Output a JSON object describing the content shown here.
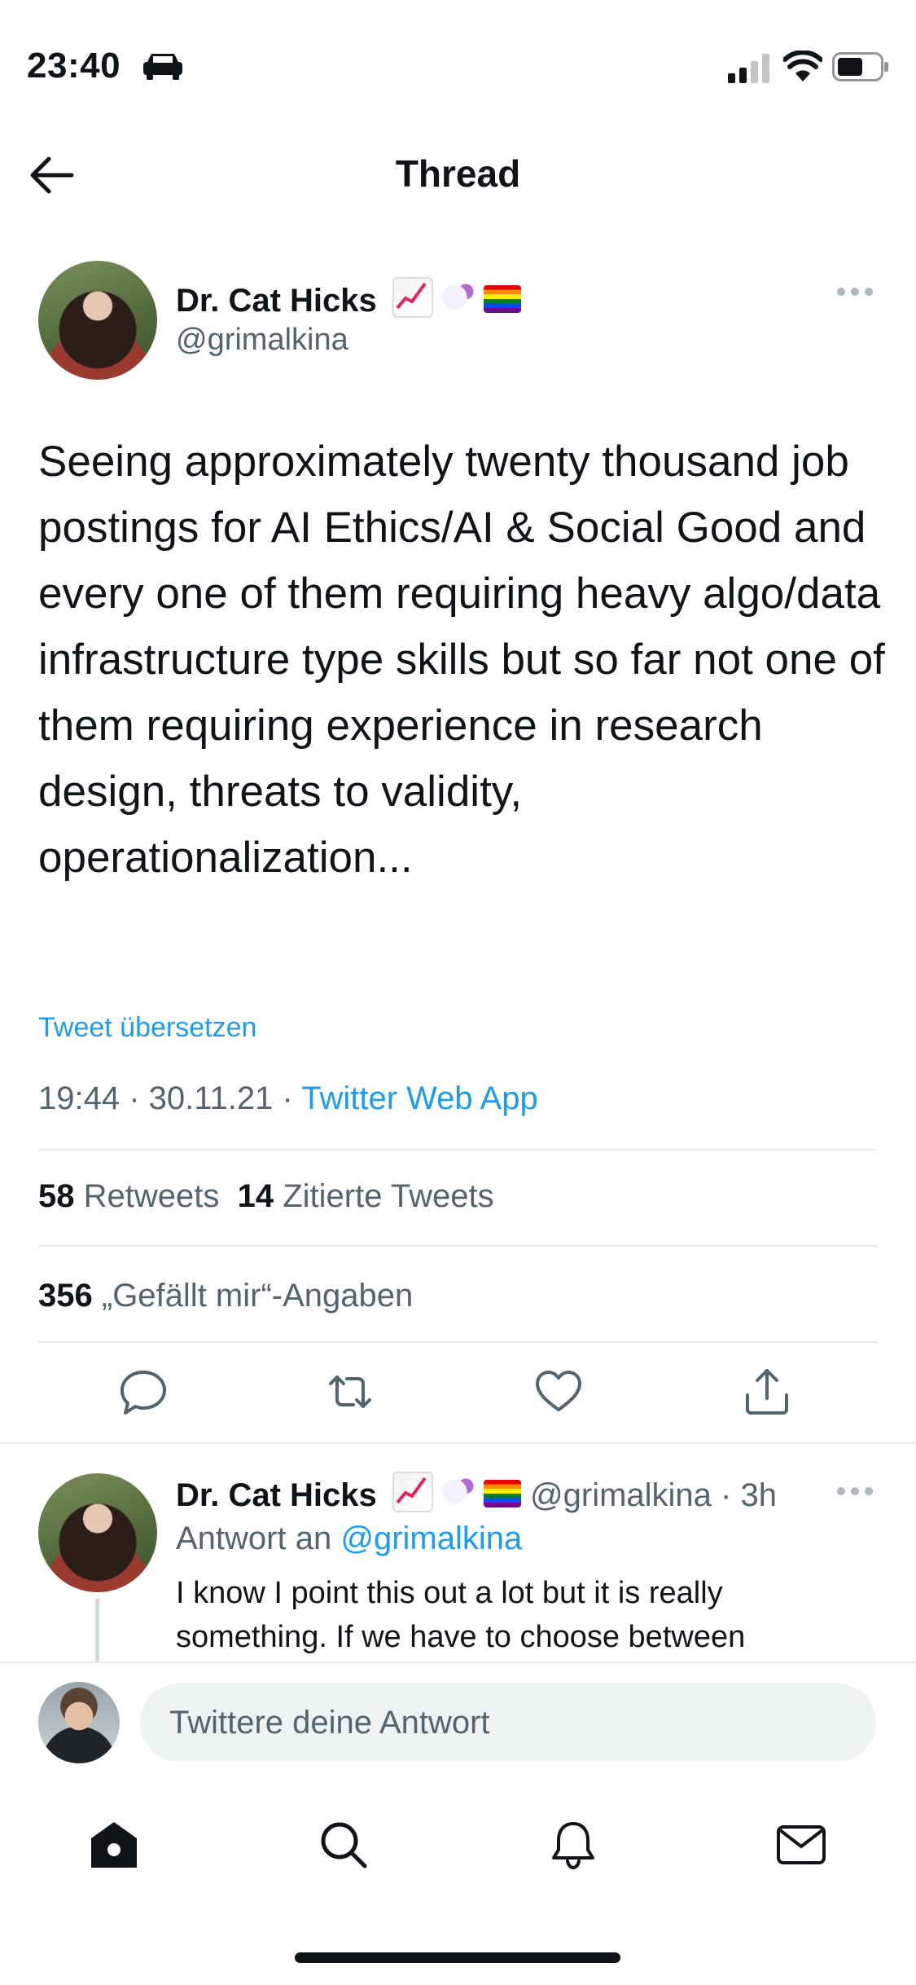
{
  "status_bar": {
    "time": "23:40"
  },
  "header": {
    "title": "Thread"
  },
  "tweet": {
    "display_name": "Dr. Cat Hicks",
    "handle": "@grimalkina",
    "text": "Seeing approximately twenty thousand job postings for AI Ethics/AI & Social Good and every one of them requiring heavy algo/data infrastructure type skills but so far not one of them requiring experience in research design, threats to validity, operationalization...",
    "translate_label": "Tweet übersetzen",
    "time": "19:44",
    "date": "30.11.21",
    "source": "Twitter Web App",
    "retweets_count": "58",
    "retweets_label": "Retweets",
    "quotes_count": "14",
    "quotes_label": "Zitierte Tweets",
    "likes_count": "356",
    "likes_label": "„Gefällt mir“-Angaben"
  },
  "reply": {
    "display_name": "Dr. Cat Hicks",
    "handle": "@grimalkina",
    "age": "3h",
    "reply_to_label": "Antwort an",
    "reply_to_handle": "@grimalkina",
    "text": "I know I point this out a lot but it is really something. If we have to choose between"
  },
  "composer": {
    "placeholder": "Twittere deine Antwort"
  },
  "colors": {
    "link": "#1d9bf0",
    "muted": "#536471",
    "text": "#0f1419",
    "divider": "#e7e9ea"
  }
}
